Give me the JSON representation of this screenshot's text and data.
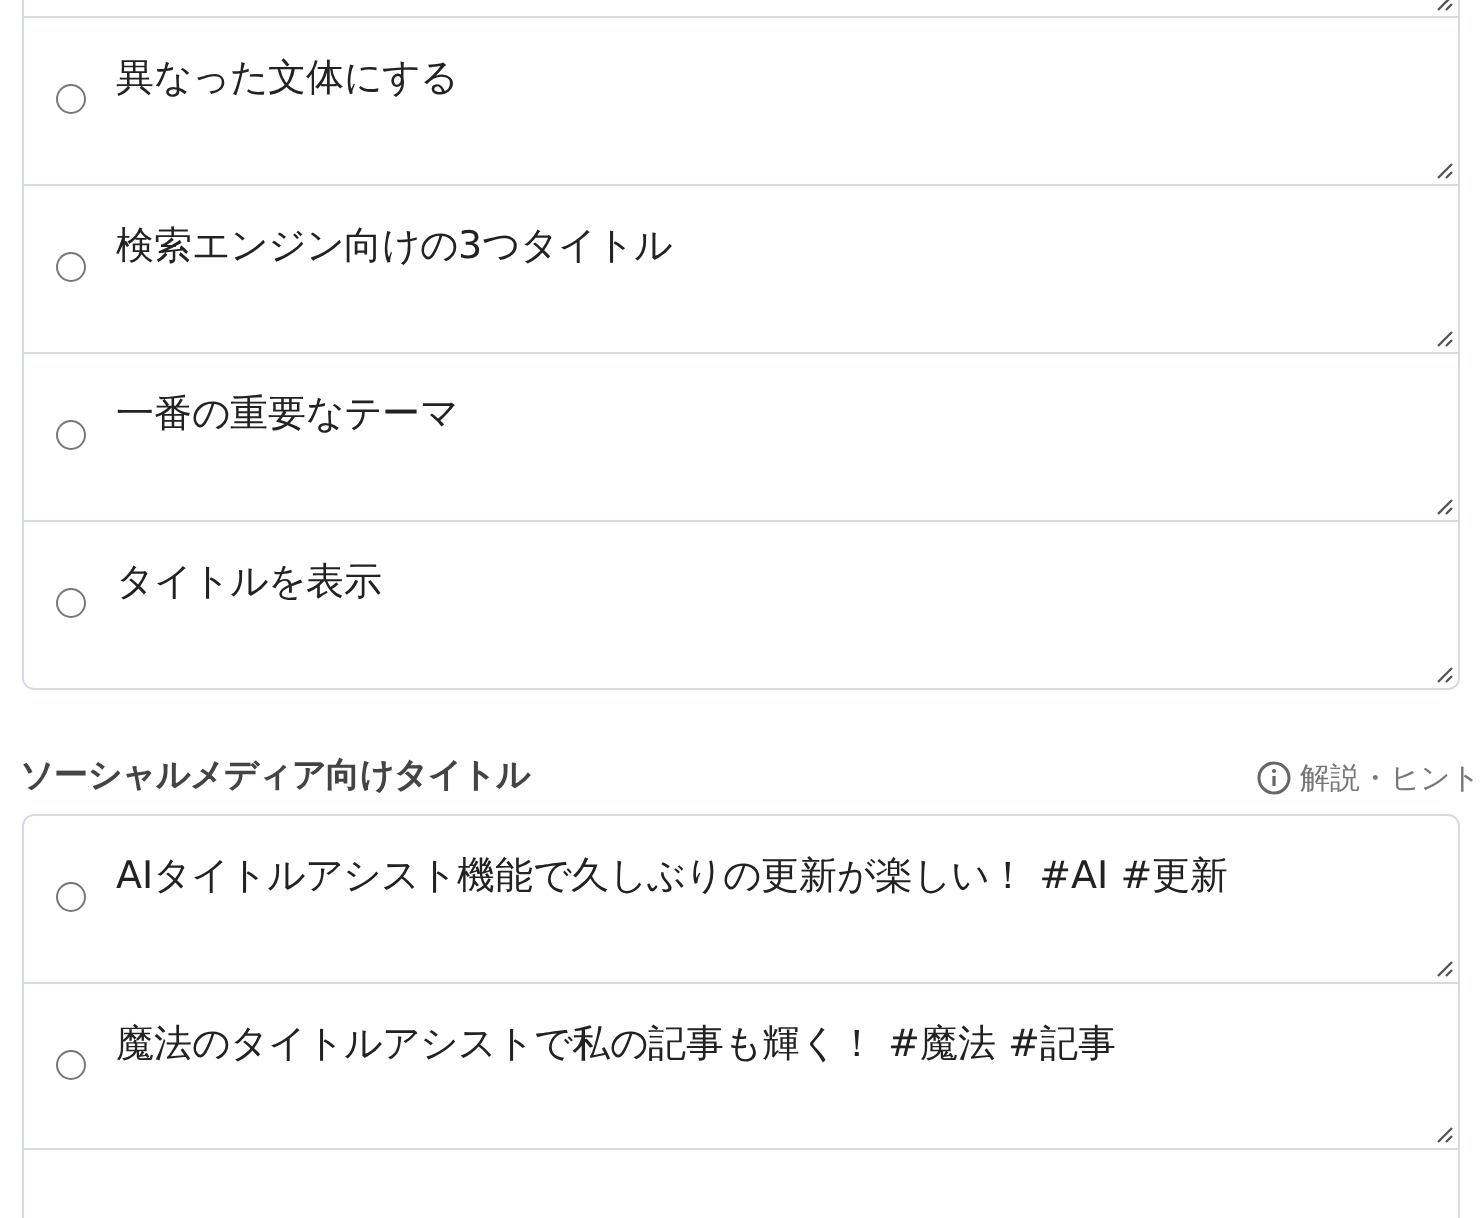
{
  "title_suggestions": [
    {
      "text": "異なった文体にする",
      "selected": false
    },
    {
      "text": "検索エンジン向けの3つタイトル",
      "selected": false
    },
    {
      "text": "一番の重要なテーマ",
      "selected": false
    },
    {
      "text": "タイトルを表示",
      "selected": false
    }
  ],
  "social_section": {
    "heading": "ソーシャルメディア向けタイトル",
    "hint": "解説・ヒント"
  },
  "social_titles": [
    {
      "text": "AIタイトルアシスト機能で久しぶりの更新が楽しい！ #AI #更新",
      "selected": false
    },
    {
      "text": "魔法のタイトルアシストで私の記事も輝く！ #魔法 #記事",
      "selected": false
    }
  ]
}
